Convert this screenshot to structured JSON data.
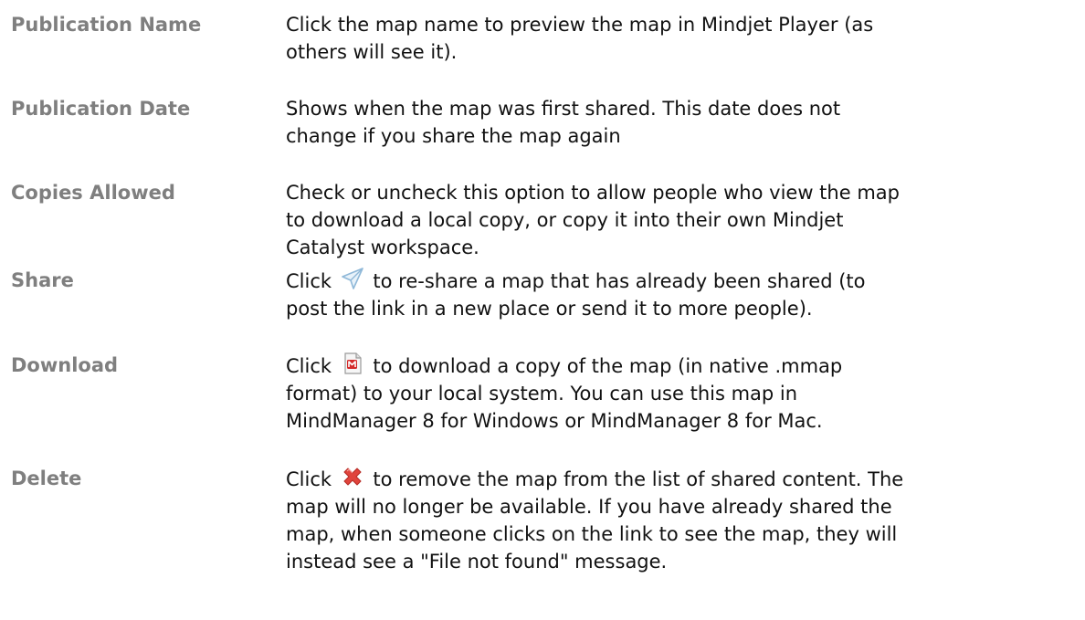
{
  "definitions": [
    {
      "term": "Publication Name",
      "lines": [
        "Click the map name to preview the map in Mindjet Player (as",
        "others will see it)."
      ]
    },
    {
      "term": "Publication Date",
      "lines": [
        "Shows when the map was first shared. This date does not",
        "change if you share the map again"
      ]
    },
    {
      "term": "Copies Allowed",
      "lines": [
        "Check or uncheck this option to allow people who view the map",
        "to download a local copy, or copy it into their own Mindjet",
        "Catalyst workspace."
      ]
    },
    {
      "term": "Share",
      "icon": "paper-plane-share-icon",
      "before_icon": "Click",
      "after_icon": "to re-share a map that has already been shared (to",
      "lines": [
        "post the link in a new place or send it to more people)."
      ]
    },
    {
      "term": "Download",
      "icon": "mmap-file-download-icon",
      "before_icon": "Click",
      "after_icon": "to download a copy of the map (in native .mmap",
      "lines": [
        "format) to your local system. You can use this map in",
        "MindManager 8 for Windows or MindManager 8 for Mac."
      ]
    },
    {
      "term": "Delete",
      "icon": "red-x-delete-icon",
      "before_icon": "Click",
      "after_icon": "to remove the map from the list of shared content. The",
      "lines": [
        "map will no longer be available. If you have already shared the",
        "map, when someone clicks on the link to see the map, they will",
        "instead see a \"File not found\" message."
      ]
    }
  ],
  "colors": {
    "term": "#7f7f7f",
    "text": "#111111",
    "share_icon": "#8fb8d8",
    "download_icon": "#d42a2a",
    "delete_icon": "#e0443c"
  }
}
